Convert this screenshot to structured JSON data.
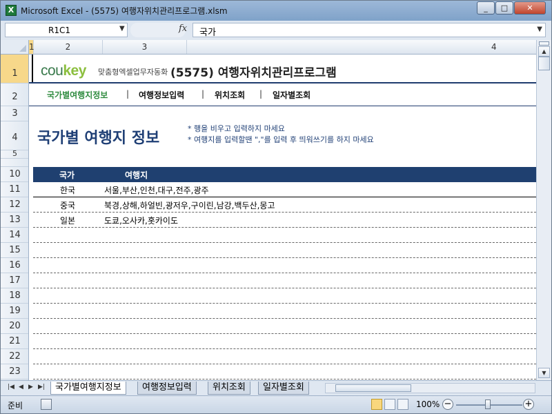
{
  "window": {
    "title": "Microsoft Excel - (5575) 여행자위치관리프로그램.xlsm",
    "app_icon_letter": "X",
    "minimize_icon": "_",
    "maximize_icon": "□",
    "close_icon": "✕"
  },
  "formula_bar": {
    "name_box": "R1C1",
    "fx_label": "fx",
    "formula": "국가"
  },
  "columns": [
    "1",
    "2",
    "3",
    "4"
  ],
  "rows": [
    "1",
    "2",
    "3",
    "4",
    "5",
    "10",
    "11",
    "12",
    "13",
    "14",
    "15",
    "16",
    "17",
    "18",
    "19",
    "20",
    "21",
    "22",
    "23"
  ],
  "header": {
    "logo_cou": "cou",
    "logo_key": "key",
    "logo_sub": "맞춤형엑셀업무자동화",
    "app_title": "(5575) 여행자위치관리프로그램"
  },
  "nav": {
    "items": [
      "국가별여행지정보",
      "여행정보입력",
      "위치조회",
      "일자별조회"
    ],
    "separator": "|",
    "active_index": 0
  },
  "section": {
    "title": "국가별 여행지 정보",
    "notes": [
      "* 행을 비우고 입력하지 마세요",
      "* 여행지를 입력할땐 \",\"를 입력 후 띄워쓰기를 하지 마세요"
    ]
  },
  "table": {
    "headers": [
      "국가",
      "여행지"
    ],
    "rows": [
      {
        "country": "한국",
        "destinations": "서울,부산,인천,대구,전주,광주"
      },
      {
        "country": "중국",
        "destinations": "북경,상해,하얼빈,광저우,구이린,남강,백두산,몽고"
      },
      {
        "country": "일본",
        "destinations": "도쿄,오사카,홋카이도"
      }
    ]
  },
  "sheet_tabs": [
    "국가별여행지정보",
    "여행정보입력",
    "위치조회",
    "일자별조회"
  ],
  "active_sheet": 0,
  "status": {
    "mode": "준비",
    "zoom": "100%",
    "zoom_minus": "−",
    "zoom_plus": "+"
  },
  "colors": {
    "accent": "#1f4070",
    "nav_active": "#2e8b3e",
    "title_blue": "#1f3f75"
  }
}
